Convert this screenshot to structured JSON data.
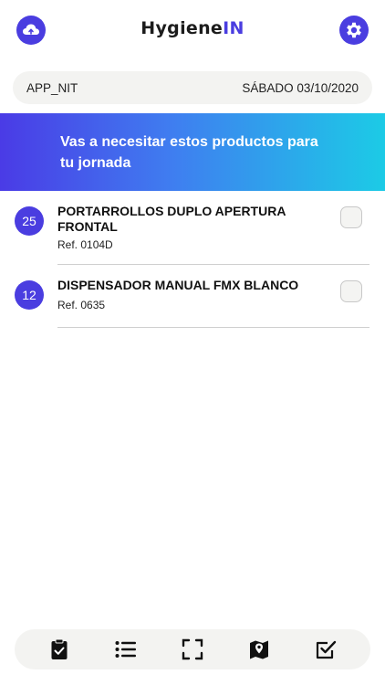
{
  "header": {
    "brand_part1": "Hygiene",
    "brand_part2": "IN",
    "left_icon": "cloud-upload-icon",
    "right_icon": "gear-icon"
  },
  "info": {
    "user": "APP_NIT",
    "date": "SÁBADO 03/10/2020"
  },
  "banner": {
    "text": "Vas a necesitar estos productos para tu jornada"
  },
  "products": [
    {
      "qty": "25",
      "name": "PORTARROLLOS DUPLO APERTURA FRONTAL",
      "ref": "Ref. 0104D",
      "checked": false
    },
    {
      "qty": "12",
      "name": "DISPENSADOR MANUAL FMX BLANCO",
      "ref": "Ref. 0635",
      "checked": false
    }
  ],
  "nav": {
    "items": [
      "clipboard-check-icon",
      "list-icon",
      "scan-frame-icon",
      "map-pin-icon",
      "checkbox-icon"
    ]
  },
  "colors": {
    "accent": "#4a3de0",
    "gradient_start": "#4a3be6",
    "gradient_end": "#1ccbe6"
  }
}
